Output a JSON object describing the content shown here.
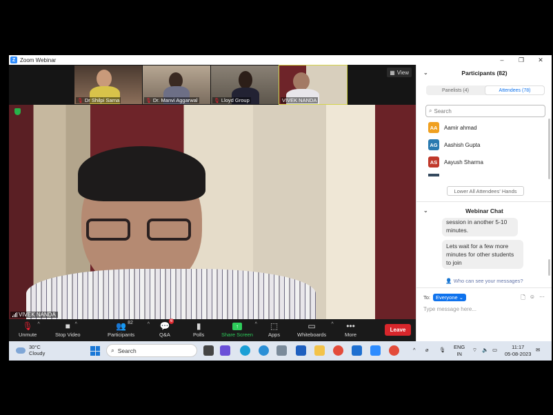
{
  "window": {
    "title": "Zoom Webinar",
    "minimize": "–",
    "restore": "❐",
    "close": "✕"
  },
  "thumbnails": [
    {
      "name": "Dr Shilpi Sarna"
    },
    {
      "name": "Dr. Manvi Aggarwal"
    },
    {
      "name": "Lloyd Group"
    },
    {
      "name": "VIVEK NANDA"
    }
  ],
  "view_button": "View",
  "main_video": {
    "speaker_name": "VIVEK NANDA"
  },
  "toolbar": {
    "unmute": "Unmute",
    "stop_video": "Stop Video",
    "participants": "Participants",
    "participants_count": "82",
    "qa": "Q&A",
    "qa_badge": "6",
    "polls": "Polls",
    "share_screen": "Share Screen",
    "apps": "Apps",
    "whiteboards": "Whiteboards",
    "more": "More",
    "leave": "Leave"
  },
  "participants_panel": {
    "title": "Participants (82)",
    "tab_panelists": "Panelists (4)",
    "tab_attendees": "Attendees (78)",
    "search_placeholder": "Search",
    "attendees": [
      {
        "initials": "AA",
        "name": "Aamir ahmad",
        "color": "#f0a020"
      },
      {
        "initials": "AG",
        "name": "Aashish Gupta",
        "color": "#2a7ab0"
      },
      {
        "initials": "AS",
        "name": "Aayush Sharma",
        "color": "#c0392b"
      }
    ],
    "lower_hands": "Lower All Attendees' Hands"
  },
  "chat": {
    "title": "Webinar Chat",
    "messages": [
      {
        "text": "session in another 5-10 minutes."
      },
      {
        "text": "Lets wait for a few more minutes for other students to join"
      }
    ],
    "who_can_see": "Who can see your messages?",
    "to_label": "To:",
    "to_value": "Everyone",
    "input_placeholder": "Type message here..."
  },
  "taskbar": {
    "temperature": "30°C",
    "weather": "Cloudy",
    "search": "Search",
    "lang_top": "ENG",
    "lang_bottom": "IN",
    "time": "11:17",
    "date": "05-08-2023"
  }
}
